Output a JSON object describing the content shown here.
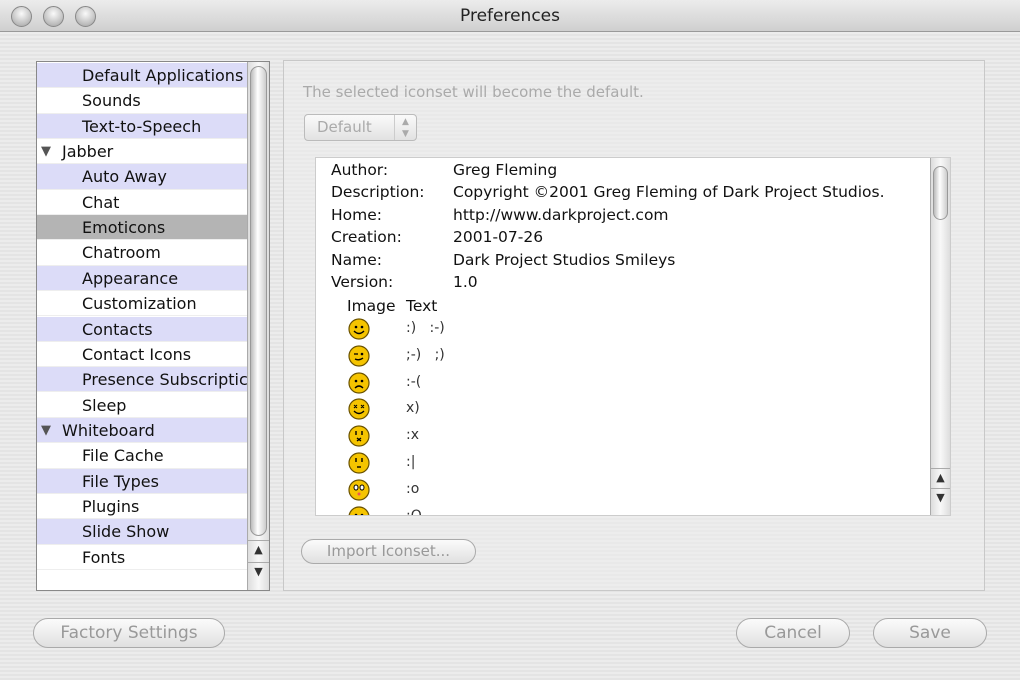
{
  "window": {
    "title": "Preferences"
  },
  "sidebar": {
    "items": [
      {
        "label": "Default Applications",
        "style": "lav"
      },
      {
        "label": "Sounds",
        "style": "white"
      },
      {
        "label": "Text-to-Speech",
        "style": "lav"
      },
      {
        "label": "Jabber",
        "style": "white",
        "header": true
      },
      {
        "label": "Auto Away",
        "style": "lav"
      },
      {
        "label": "Chat",
        "style": "white"
      },
      {
        "label": "Emoticons",
        "style": "sel"
      },
      {
        "label": "Chatroom",
        "style": "white"
      },
      {
        "label": "Appearance",
        "style": "lav"
      },
      {
        "label": "Customization",
        "style": "white"
      },
      {
        "label": "Contacts",
        "style": "lav"
      },
      {
        "label": "Contact Icons",
        "style": "white"
      },
      {
        "label": "Presence Subscriptic",
        "style": "lav"
      },
      {
        "label": "Sleep",
        "style": "white"
      },
      {
        "label": "Whiteboard",
        "style": "lav",
        "header": true
      },
      {
        "label": "File Cache",
        "style": "white"
      },
      {
        "label": "File Types",
        "style": "lav"
      },
      {
        "label": "Plugins",
        "style": "white"
      },
      {
        "label": "Slide Show",
        "style": "lav"
      },
      {
        "label": "Fonts",
        "style": "white"
      }
    ],
    "selected": "Emoticons"
  },
  "panel": {
    "hint": "The selected iconset will become the default.",
    "iconset_select": "Default",
    "info": [
      {
        "key": "Author:",
        "value": "Greg Fleming"
      },
      {
        "key": "Description:",
        "value": "Copyright ©2001 Greg Fleming of Dark Project Studios."
      },
      {
        "key": "Home:",
        "value": "http://www.darkproject.com"
      },
      {
        "key": "Creation:",
        "value": "2001-07-26"
      },
      {
        "key": "Name:",
        "value": "Dark Project Studios Smileys"
      },
      {
        "key": "Version:",
        "value": "1.0"
      }
    ],
    "table_headers": {
      "image": "Image",
      "text": "Text"
    },
    "emoticons": [
      {
        "icon": "smile",
        "text": ":)   :-)"
      },
      {
        "icon": "wink",
        "text": ";-)   ;)"
      },
      {
        "icon": "sad",
        "text": ":-("
      },
      {
        "icon": "dead",
        "text": "x)"
      },
      {
        "icon": "shocked",
        "text": ":x"
      },
      {
        "icon": "neutral",
        "text": ":|"
      },
      {
        "icon": "surprised",
        "text": ":o"
      },
      {
        "icon": "partial",
        "text": ":O"
      }
    ],
    "import_button": "Import Iconset..."
  },
  "footer": {
    "factory": "Factory Settings",
    "cancel": "Cancel",
    "save": "Save"
  },
  "colors": {
    "row_alt": "#dcdcf8",
    "selected": "#b4b4b4",
    "smiley": "#f5c400"
  }
}
